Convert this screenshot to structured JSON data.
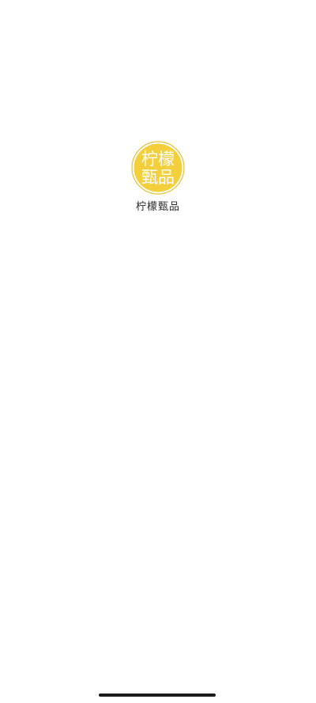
{
  "splash": {
    "logo": {
      "line1": "柠檬",
      "line2": "甄品",
      "fill_color": "#F2CF3B",
      "ring_color": "#E3C235",
      "text_color": "#ffffff"
    },
    "app_name": "柠檬甄品"
  },
  "system": {
    "home_indicator_color": "#1a1a1a"
  }
}
